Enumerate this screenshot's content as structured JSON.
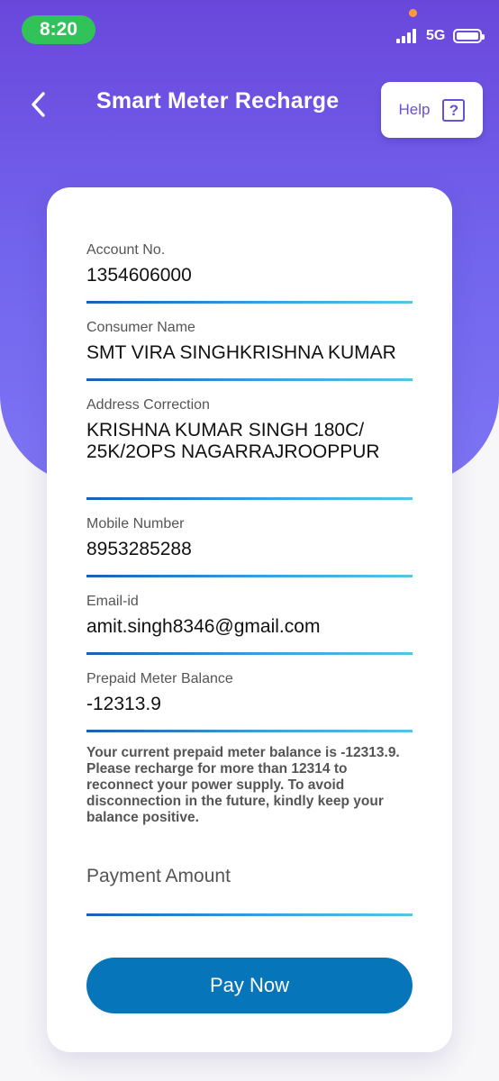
{
  "status_bar": {
    "time": "8:20",
    "network": "5G"
  },
  "header": {
    "title": "Smart Meter Recharge",
    "help_label": "Help",
    "help_icon_glyph": "?"
  },
  "colors": {
    "accent_purple": "#6a47dc",
    "primary_button": "#0775ba",
    "time_pill": "#31c25a"
  },
  "fields": {
    "account_no": {
      "label": "Account No.",
      "value": "1354606000"
    },
    "consumer_name": {
      "label": "Consumer Name",
      "value": "SMT VIRA SINGHKRISHNA KUMAR"
    },
    "address": {
      "label": "Address Correction",
      "value": "KRISHNA KUMAR SINGH 180C/ 25K/2OPS NAGARRAJROOPPUR"
    },
    "mobile": {
      "label": "Mobile Number",
      "value": "8953285288"
    },
    "email": {
      "label": "Email-id",
      "value": "amit.singh8346@gmail.com"
    },
    "balance": {
      "label": "Prepaid Meter Balance",
      "value": "-12313.9"
    }
  },
  "notice": "Your current prepaid meter balance is -12313.9. Please recharge for more than 12314 to reconnect your power supply. To avoid disconnection in the future, kindly keep your balance positive.",
  "payment": {
    "placeholder": "Payment Amount",
    "value": "",
    "button_label": "Pay Now"
  }
}
